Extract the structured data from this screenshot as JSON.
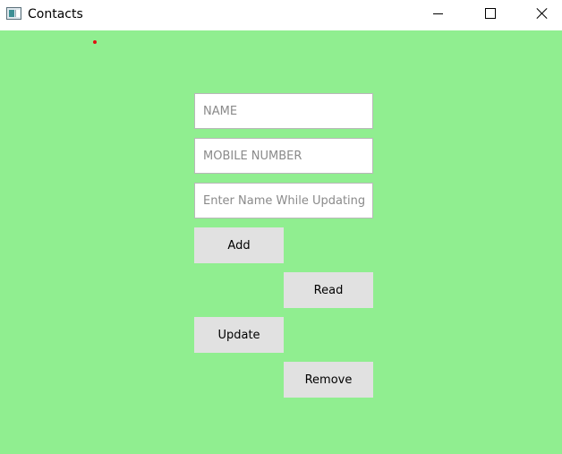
{
  "window": {
    "title": "Contacts",
    "icon": "app-window-icon",
    "controls": [
      "minimize-icon",
      "maximize-icon",
      "close-icon"
    ]
  },
  "form": {
    "name_placeholder": "NAME",
    "mobile_placeholder": "MOBILE NUMBER",
    "update_name_placeholder": "Enter Name While Updating"
  },
  "buttons": {
    "add": "Add",
    "read": "Read",
    "update": "Update",
    "remove": "Remove"
  },
  "colors": {
    "background": "#90ee90",
    "button_face": "#e1e1e1",
    "marker_dot": "#e01010"
  }
}
